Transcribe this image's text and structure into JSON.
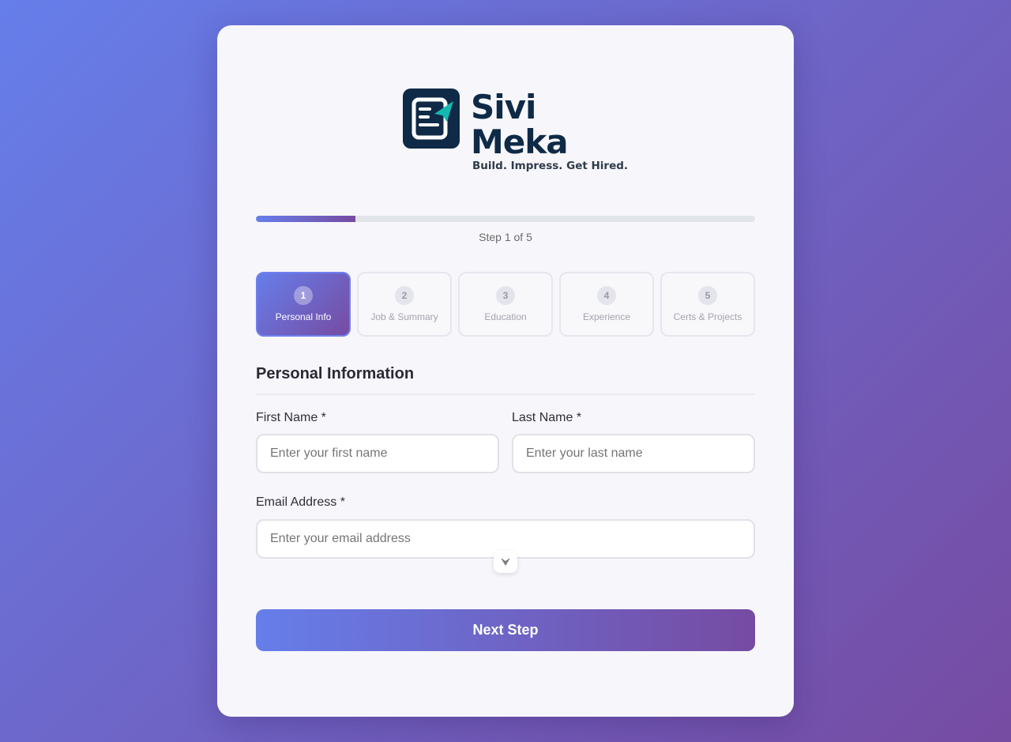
{
  "brand": {
    "name_line1": "Sivi",
    "name_line2": "Meka",
    "tagline": "Build. Impress. Get Hired.",
    "color_dark": "#0e2a47",
    "color_accent": "#14b8b0"
  },
  "progress": {
    "current_step": 1,
    "total_steps": 5,
    "fraction": 0.2,
    "label": "Step 1 of 5"
  },
  "steps": [
    {
      "number": "1",
      "label": "Personal Info",
      "active": true
    },
    {
      "number": "2",
      "label": "Job & Summary",
      "active": false
    },
    {
      "number": "3",
      "label": "Education",
      "active": false
    },
    {
      "number": "4",
      "label": "Experience",
      "active": false
    },
    {
      "number": "5",
      "label": "Certs & Projects",
      "active": false
    }
  ],
  "form": {
    "section_title": "Personal Information",
    "first_name": {
      "label": "First Name *",
      "placeholder": "Enter your first name",
      "value": ""
    },
    "last_name": {
      "label": "Last Name *",
      "placeholder": "Enter your last name",
      "value": ""
    },
    "email": {
      "label": "Email Address *",
      "placeholder": "Enter your email address",
      "value": ""
    },
    "scroll_icon": "chevron-down-icon"
  },
  "actions": {
    "next_label": "Next Step"
  },
  "theme": {
    "gradient_start": "#667eea",
    "gradient_end": "#764ba2"
  }
}
